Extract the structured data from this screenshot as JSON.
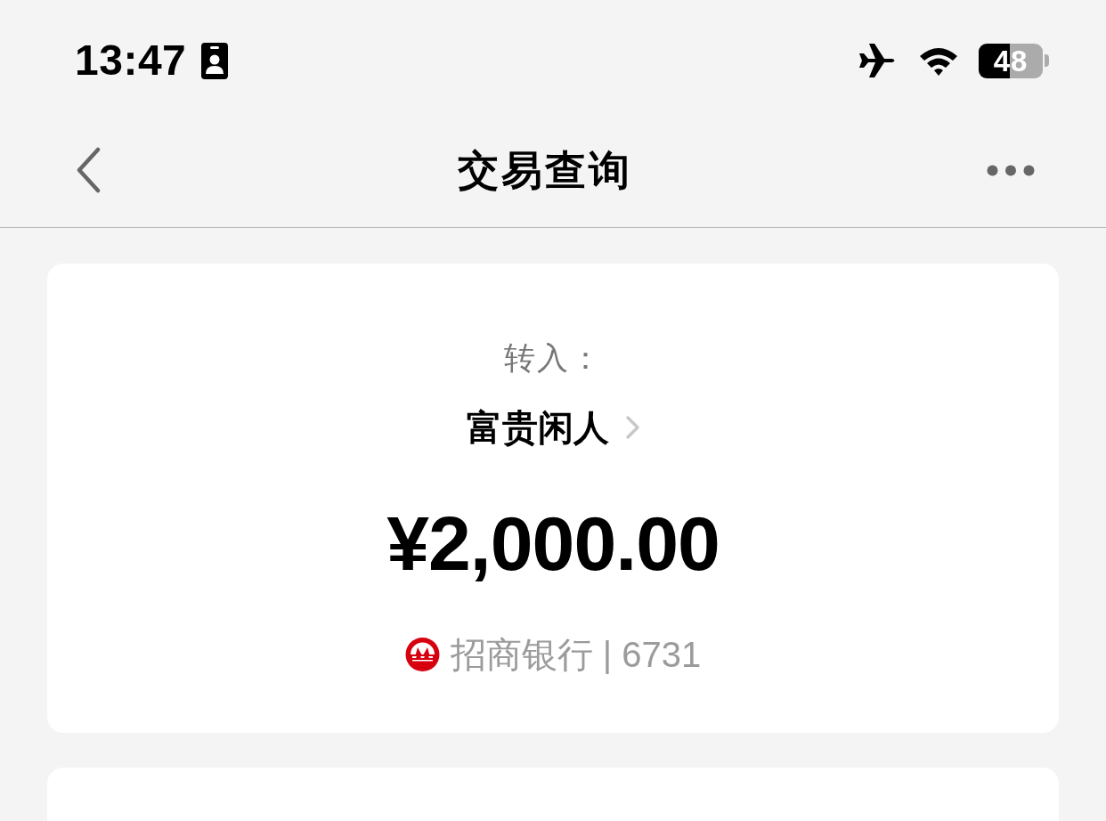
{
  "status_bar": {
    "time": "13:47",
    "battery": "48"
  },
  "nav_bar": {
    "title": "交易查询"
  },
  "transfer": {
    "label": "转入：",
    "payee": "富贵闲人",
    "amount": "¥2,000.00",
    "bank": "招商银行 | 6731"
  }
}
